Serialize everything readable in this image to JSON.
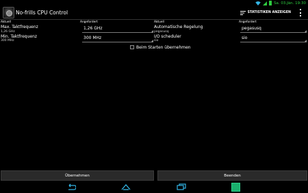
{
  "status": {
    "time": "Sa. 03.Jän. 19:30"
  },
  "app": {
    "title": "No-frills CPU Control"
  },
  "actions": {
    "stats_label": "STATISTIKEN ANZEIGEN"
  },
  "left": {
    "col_current": "Aktuell",
    "col_required": "Angefordert",
    "max_label": "Max. Taktfrequenz",
    "max_current": "1,26 GHz",
    "max_value": "1,26 GHz",
    "min_label": "Min. Taktfrequenz",
    "min_current": "300 MHz",
    "min_value": "300 MHz"
  },
  "right": {
    "col_current": "Aktuell",
    "col_required": "Angefordert",
    "gov_label": "Automatische Regelung",
    "gov_current": "pegasusq",
    "gov_value": "pegasusq",
    "io_label": "I/O scheduler",
    "io_current": "sio",
    "io_value": "sio"
  },
  "boot_checkbox": {
    "label": "Beim Starten übernehmen",
    "checked": false
  },
  "buttons": {
    "apply": "Übernehmen",
    "quit": "Beenden"
  },
  "nav": {
    "back": "back-icon",
    "home": "home-icon",
    "recents": "recents-icon",
    "app": "app-icon"
  }
}
